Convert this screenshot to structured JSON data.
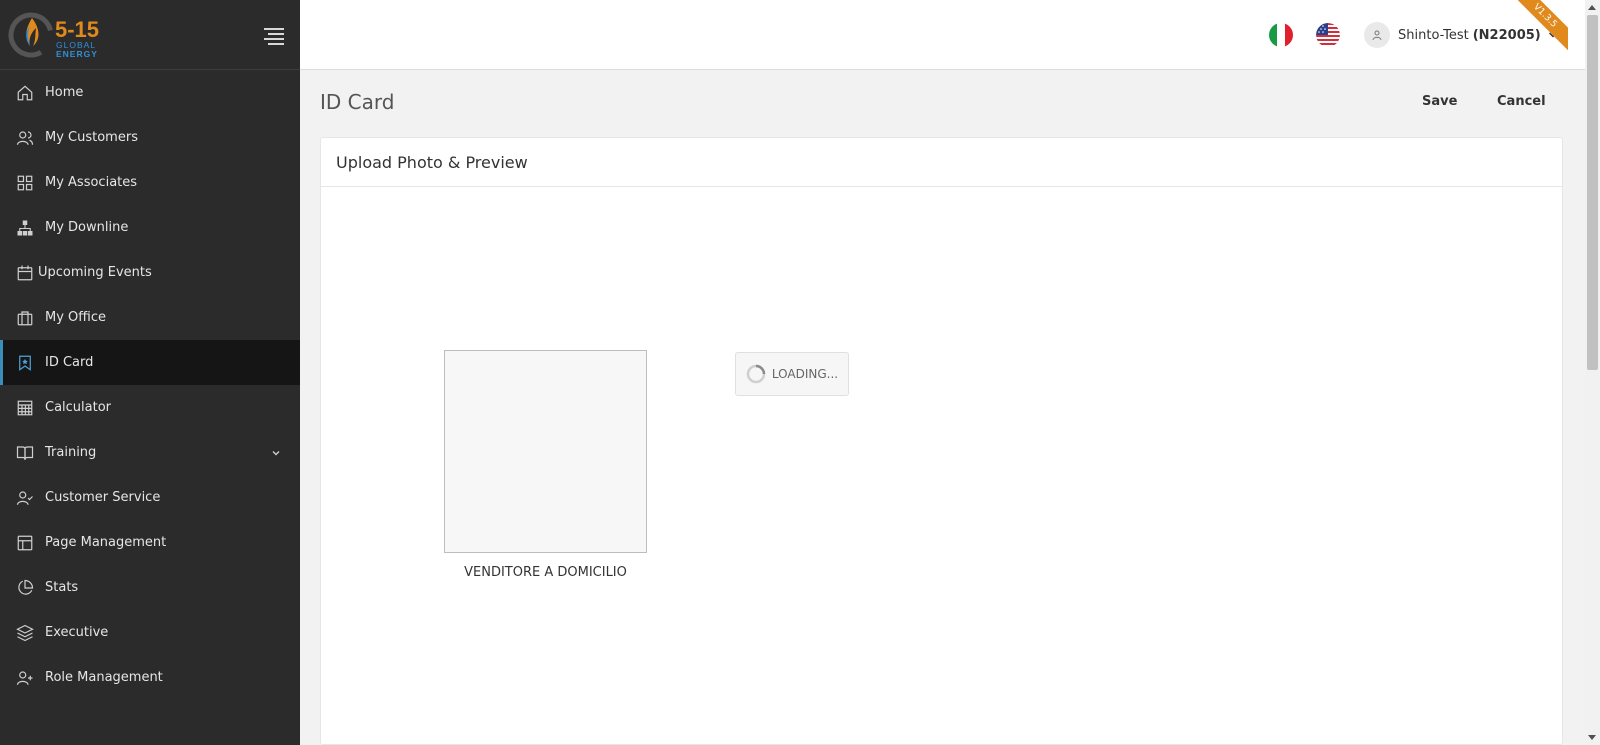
{
  "brand": {
    "logo_text": "5-15",
    "logo_sub1": "GLOBAL",
    "logo_sub2": "ENERGY"
  },
  "sidebar": {
    "items": [
      {
        "label": "Home",
        "icon": "home-icon"
      },
      {
        "label": "My Customers",
        "icon": "users-icon"
      },
      {
        "label": "My Associates",
        "icon": "grid-icon"
      },
      {
        "label": "My Downline",
        "icon": "org-chart-icon"
      },
      {
        "label": "Upcoming Events",
        "icon": "calendar-icon"
      },
      {
        "label": "My Office",
        "icon": "briefcase-icon"
      },
      {
        "label": "ID Card",
        "icon": "bookmark-star-icon",
        "active": true
      },
      {
        "label": "Calculator",
        "icon": "calculator-icon"
      },
      {
        "label": "Training",
        "icon": "book-icon",
        "expandable": true
      },
      {
        "label": "Customer Service",
        "icon": "user-check-icon"
      },
      {
        "label": "Page Management",
        "icon": "layout-icon"
      },
      {
        "label": "Stats",
        "icon": "pie-chart-icon"
      },
      {
        "label": "Executive",
        "icon": "layers-icon"
      },
      {
        "label": "Role Management",
        "icon": "user-plus-icon"
      }
    ]
  },
  "header": {
    "languages": [
      "Italian",
      "English (US)"
    ],
    "user_name": "Shinto-Test",
    "user_code": "(N22005)",
    "version": "V1.3.5"
  },
  "page": {
    "title": "ID Card",
    "save_label": "Save",
    "cancel_label": "Cancel"
  },
  "card": {
    "title": "Upload Photo & Preview",
    "photo_caption": "VENDITORE A DOMICILIO",
    "loading_label": "LOADING..."
  },
  "colors": {
    "sidebar_bg": "#2b2b2b",
    "active_bg": "#151515",
    "active_accent": "#3c8dbc",
    "brand_orange": "#e08a1e",
    "brand_blue": "#2f8fd8"
  }
}
